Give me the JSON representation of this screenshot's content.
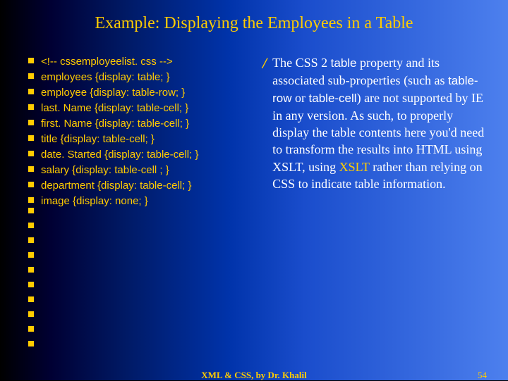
{
  "title": "Example: Displaying the Employees in a Table",
  "code": [
    "<!-- cssemployeelist. css -->",
    "employees {display: table; }",
    "employee {display: table-row; }",
    "last. Name {display: table-cell; }",
    "first. Name {display: table-cell; }",
    "title {display: table-cell; }",
    "date. Started {display: table-cell; }",
    "salary {display: table-cell ; }",
    "department {display: table-cell; }",
    "image {display: none; }"
  ],
  "para": {
    "p1": "The CSS 2 ",
    "t1": "table",
    "p2": " property and its associated sub-properties (such as ",
    "t2": "table-row",
    "p3": " or ",
    "t3": "table-cell",
    "p4": ") are not supported by IE in any version. As such, to properly display the table contents here you'd need to transform the results into HTML using XSLT, using ",
    "h1": "XSLT",
    "p5": " rather than relying on CSS to indicate table information."
  },
  "footer_center": "XML & CSS, by Dr. Khalil",
  "footer_right": "54"
}
